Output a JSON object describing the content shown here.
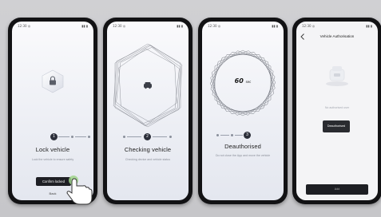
{
  "colors": {
    "background": "#c9c9cc",
    "phone_frame": "#121214",
    "screen_bg": "#f2f3f7",
    "dark_button": "#1e1f24",
    "step_active": "#2c2f3a",
    "step_inactive": "#8a8f9b"
  },
  "phones": [
    {
      "status_left": "12:30 ◎",
      "status_right": "▮▮ ▮",
      "icon": "lock-icon",
      "step_active_number": "1",
      "title": "Lock vehicle",
      "description": "Lock the vehicle to ensure safety",
      "primary_button": "Confirm locked",
      "secondary_link": "Back",
      "overlay_icon": "tap-hand-icon"
    },
    {
      "status_left": "12:30 ◎",
      "status_right": "▮▮ ▮",
      "icon": "car-icon",
      "step_active_number": "2",
      "title": "Checking vehicle",
      "description": "Checking device and vehicle status"
    },
    {
      "status_left": "12:30 ◎",
      "status_right": "▮▮ ▮",
      "countdown_value": "60",
      "countdown_unit": "sec",
      "step_active_number": "3",
      "title": "Deauthorised",
      "description": "Do not close the App and move the vehicle"
    },
    {
      "status_left": "12:30 ◎",
      "status_right": "▮▮ ▮",
      "nav_title": "Vehicle Authorisation",
      "back_icon": "chevron-left-icon",
      "illustration": "car-device-illustration",
      "status_text": "No authorised user",
      "status_badge": "Deauthorised",
      "bottom_button": "Add"
    }
  ]
}
